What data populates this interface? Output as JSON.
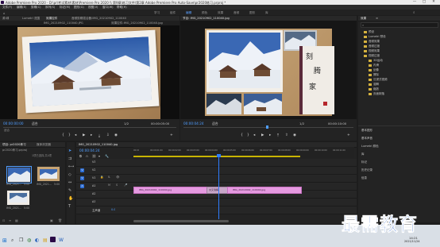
{
  "window": {
    "title": "Adobe Premiere Pro 2020 - D:\\pr\\考试素材\\素材\\Premiere Pro 2020 \\\\ 第9章\\练习文件\\第2章 Adobe Premiere Pro Auto-Save\\pr2020练习.prproj *",
    "controls": [
      "—",
      "□",
      "✕"
    ]
  },
  "menu": [
    "文件(F)",
    "编辑(E)",
    "剪辑(C)",
    "序列(S)",
    "标记(M)",
    "图形(G)",
    "视图(V)",
    "窗口(W)",
    "帮助(H)"
  ],
  "workspaces": [
    {
      "label": "学习",
      "active": false
    },
    {
      "label": "组件",
      "active": false
    },
    {
      "label": "编辑",
      "active": true
    },
    {
      "label": "颜色",
      "active": false
    },
    {
      "label": "效果",
      "active": false
    },
    {
      "label": "音频",
      "active": false
    },
    {
      "label": "图形",
      "active": false
    },
    {
      "label": "库",
      "active": false
    }
  ],
  "source_monitor": {
    "tabs": [
      "源:绿",
      "Lumetri 范围",
      "效果控件",
      "音频剪辑混合器:IMG_20210902_110040"
    ],
    "inner_tabs": [
      "IMG_20210902_110040.JPG",
      "效果控件:IMG_20210902_110040.jpg"
    ],
    "timecode": "00:00:00:00",
    "fit_label": "适合",
    "ratio": "1/2",
    "duration": "00:00:05:00",
    "scale": "适合"
  },
  "program_monitor": {
    "tab": "节目: IMG_20210902_110040.jpg",
    "timecode": "00:00:04:24",
    "fit_label": "适合",
    "ratio": "1/2",
    "duration": "00:00:10:00",
    "calligraphy": [
      "刻",
      "腾",
      "家"
    ]
  },
  "right_panel": {
    "tabs": [
      "效果",
      "≡"
    ],
    "search_placeholder": "",
    "tree": [
      {
        "label": "预设",
        "indent": 1
      },
      {
        "label": "Lumetri 预设",
        "indent": 1
      },
      {
        "label": "音频效果",
        "indent": 1
      },
      {
        "label": "音频过渡",
        "indent": 1
      },
      {
        "label": "视频效果",
        "indent": 1
      },
      {
        "label": "视频过渡",
        "indent": 1
      },
      {
        "label": "3D运动",
        "indent": 2
      },
      {
        "label": "内滑",
        "indent": 2
      },
      {
        "label": "划像",
        "indent": 2
      },
      {
        "label": "擦除",
        "indent": 2
      },
      {
        "label": "沉浸式视频",
        "indent": 2
      },
      {
        "label": "溶解",
        "indent": 2
      },
      {
        "label": "缩放",
        "indent": 2
      },
      {
        "label": "页面剥落",
        "indent": 2
      }
    ],
    "sections": [
      "基本图形",
      "基本声音",
      "Lumetri 颜色",
      "库",
      "标记",
      "历史记录",
      "信息"
    ]
  },
  "project_panel": {
    "tabs": [
      "项目: pr2020练习",
      "媒体浏览器"
    ],
    "path": "pr2020练习.prproj",
    "count": "1项已选择,共4项",
    "clips": [
      {
        "name": "IMG_2021...",
        "dur": "5:00"
      },
      {
        "name": "IMG_2021...",
        "dur": "5:00"
      },
      {
        "name": "IMG_2021...",
        "dur": "5:00"
      }
    ]
  },
  "timeline": {
    "tab": "IMG_20210902_110040.jpg",
    "timecode": "00:00:04:24",
    "ruler": [
      "00:00",
      "00:00:01:00",
      "00:00:02:00",
      "00:00:03:00",
      "00:00:04:00",
      "00:00:05:00",
      "00:00:06:00",
      "00:00:07:00",
      "00:00:08:00",
      "00:00:09:00",
      "00:00:10:00",
      "00:00:11:00"
    ],
    "tracks": [
      "V3",
      "V2",
      "V1",
      "A1",
      "A2",
      "A3"
    ],
    "master": "主声道",
    "master_value": "0.0",
    "clip1": "IMG_20210902_110040.jpg",
    "clip2": "IMG_20210902_110040.jpg",
    "transition": "交叉溶解"
  },
  "taskbar": {
    "time": "14:21",
    "date": "2021/11/24"
  },
  "watermark": "最需教育",
  "colors": {
    "accent": "#4f9dff",
    "clip": "#e59ae0",
    "playhead": "#2f7dff",
    "folder": "#d4b13e"
  }
}
